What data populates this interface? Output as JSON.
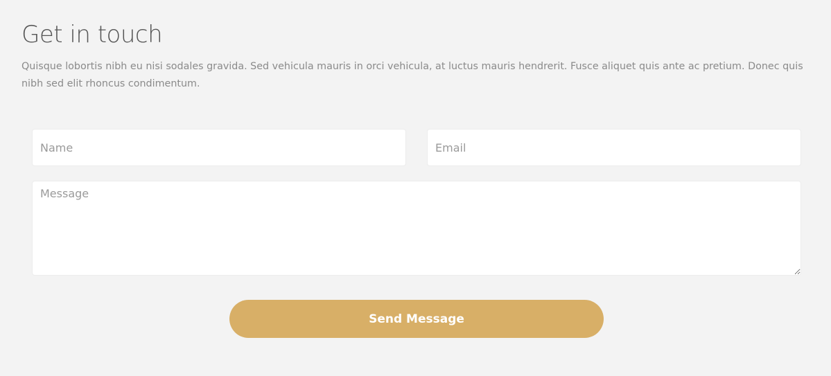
{
  "contact": {
    "title": "Get in touch",
    "intro": "Quisque lobortis nibh eu nisi sodales gravida. Sed vehicula mauris in orci vehicula, at luctus mauris hendrerit. Fusce aliquet quis ante ac pretium. Donec quis nibh sed elit rhoncus condimentum.",
    "form": {
      "name_placeholder": "Name",
      "email_placeholder": "Email",
      "message_placeholder": "Message",
      "submit_label": "Send Message"
    }
  },
  "colors": {
    "background": "#f3f3f3",
    "accent": "#d8af67",
    "title_text": "#555555",
    "body_text": "#8a8a8a",
    "field_background": "#ffffff"
  }
}
